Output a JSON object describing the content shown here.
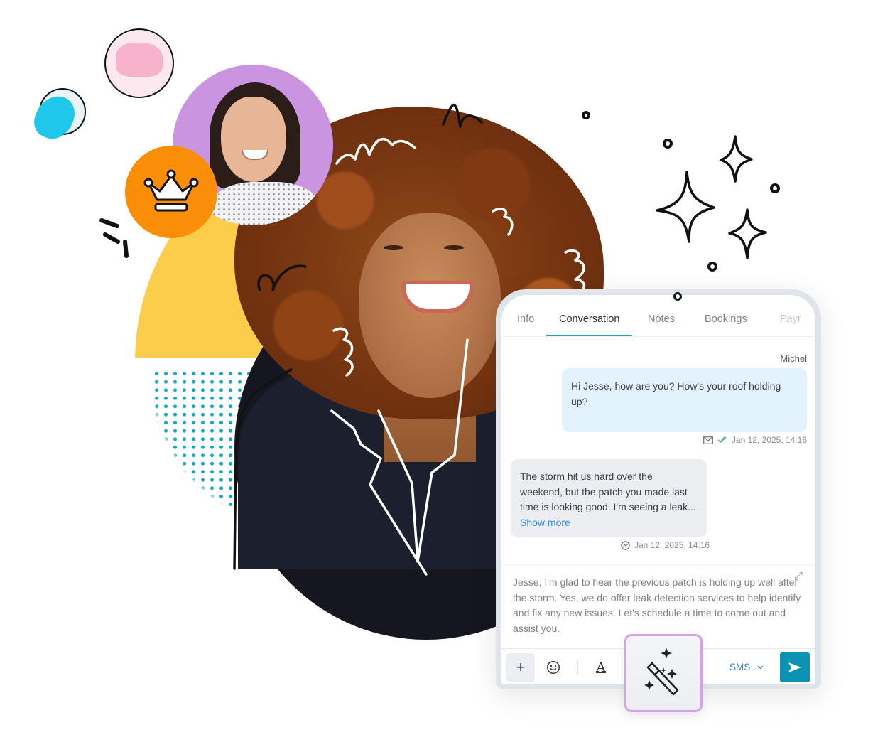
{
  "colors": {
    "accent_teal": "#19a8b8",
    "send_button": "#0c93b4",
    "link_blue": "#2f8de4",
    "outgoing_bubble": "#e3f3fe",
    "incoming_bubble": "#ebedf1",
    "magic_border": "#d7a2e5",
    "yellow_shape": "#fbcd4a",
    "purple_circle": "#cb94e0",
    "orange_circle": "#fa8f07"
  },
  "decor": {
    "crown_badge_icon": "crown-icon",
    "sparkles_icon": "four-point-stars"
  },
  "tabs": [
    {
      "label": "Info",
      "active": false
    },
    {
      "label": "Conversation",
      "active": true
    },
    {
      "label": "Notes",
      "active": false
    },
    {
      "label": "Bookings",
      "active": false
    },
    {
      "label": "Payr",
      "active": false
    }
  ],
  "conversation": {
    "outgoing": {
      "sender": "Michel",
      "text": "Hi Jesse, how are you? How's your roof holding up?",
      "timestamp": "Jan 12, 2025, 14:16",
      "channel_icon": "envelope-icon",
      "status_icon": "double-check-icon"
    },
    "incoming": {
      "text": "The storm hit us hard over the weekend, but the patch you made last time is looking good. I'm seeing a leak...",
      "show_more_label": "Show more",
      "timestamp": "Jan 12, 2025, 14:16",
      "channel_icon": "messenger-icon"
    }
  },
  "composer": {
    "draft_text": "Jesse, I'm glad to hear the previous patch is holding up well after the storm. Yes, we do offer leak detection services to help identify and fix any new issues. Let's schedule a time to come out and assist you."
  },
  "toolbar": {
    "add_label": "+",
    "emoji_icon": "smiley-icon",
    "format_label": "A",
    "channel_selected": "SMS",
    "magic_icon": "magic-wand-icon",
    "send_icon": "send-icon"
  }
}
